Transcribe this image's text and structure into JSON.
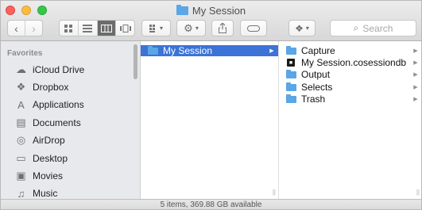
{
  "window": {
    "title": "My Session",
    "status_text": "5 items, 369.88 GB available"
  },
  "toolbar": {
    "back_icon": "chevron-left",
    "forward_icon": "chevron-right",
    "view_modes": [
      "icon-view",
      "list-view",
      "column-view",
      "cover-flow-view"
    ],
    "active_view": "column-view",
    "arrange_icon": "grid-icon",
    "action_icon": "gear-icon",
    "share_icon": "share-icon",
    "tag_icon": "tag-icon",
    "dropbox_icon": "dropbox-icon",
    "search_placeholder": "Search"
  },
  "sidebar": {
    "heading": "Favorites",
    "items": [
      {
        "label": "iCloud Drive",
        "icon": "cloud-icon"
      },
      {
        "label": "Dropbox",
        "icon": "dropbox-icon"
      },
      {
        "label": "Applications",
        "icon": "applications-icon"
      },
      {
        "label": "Documents",
        "icon": "documents-icon"
      },
      {
        "label": "AirDrop",
        "icon": "airdrop-icon"
      },
      {
        "label": "Desktop",
        "icon": "desktop-icon"
      },
      {
        "label": "Movies",
        "icon": "movies-icon"
      },
      {
        "label": "Music",
        "icon": "music-icon"
      }
    ]
  },
  "columns": {
    "first": [
      {
        "label": "My Session",
        "type": "folder",
        "selected": true
      }
    ],
    "second": [
      {
        "label": "Capture",
        "type": "folder"
      },
      {
        "label": "My Session.cosessiondb",
        "type": "file"
      },
      {
        "label": "Output",
        "type": "folder"
      },
      {
        "label": "Selects",
        "type": "folder"
      },
      {
        "label": "Trash",
        "type": "folder"
      }
    ]
  },
  "colors": {
    "selection": "#3b73d6",
    "folder": "#5aa6e6",
    "close": "#fc615d",
    "minimize": "#fdbc40",
    "maximize": "#34c84a"
  }
}
